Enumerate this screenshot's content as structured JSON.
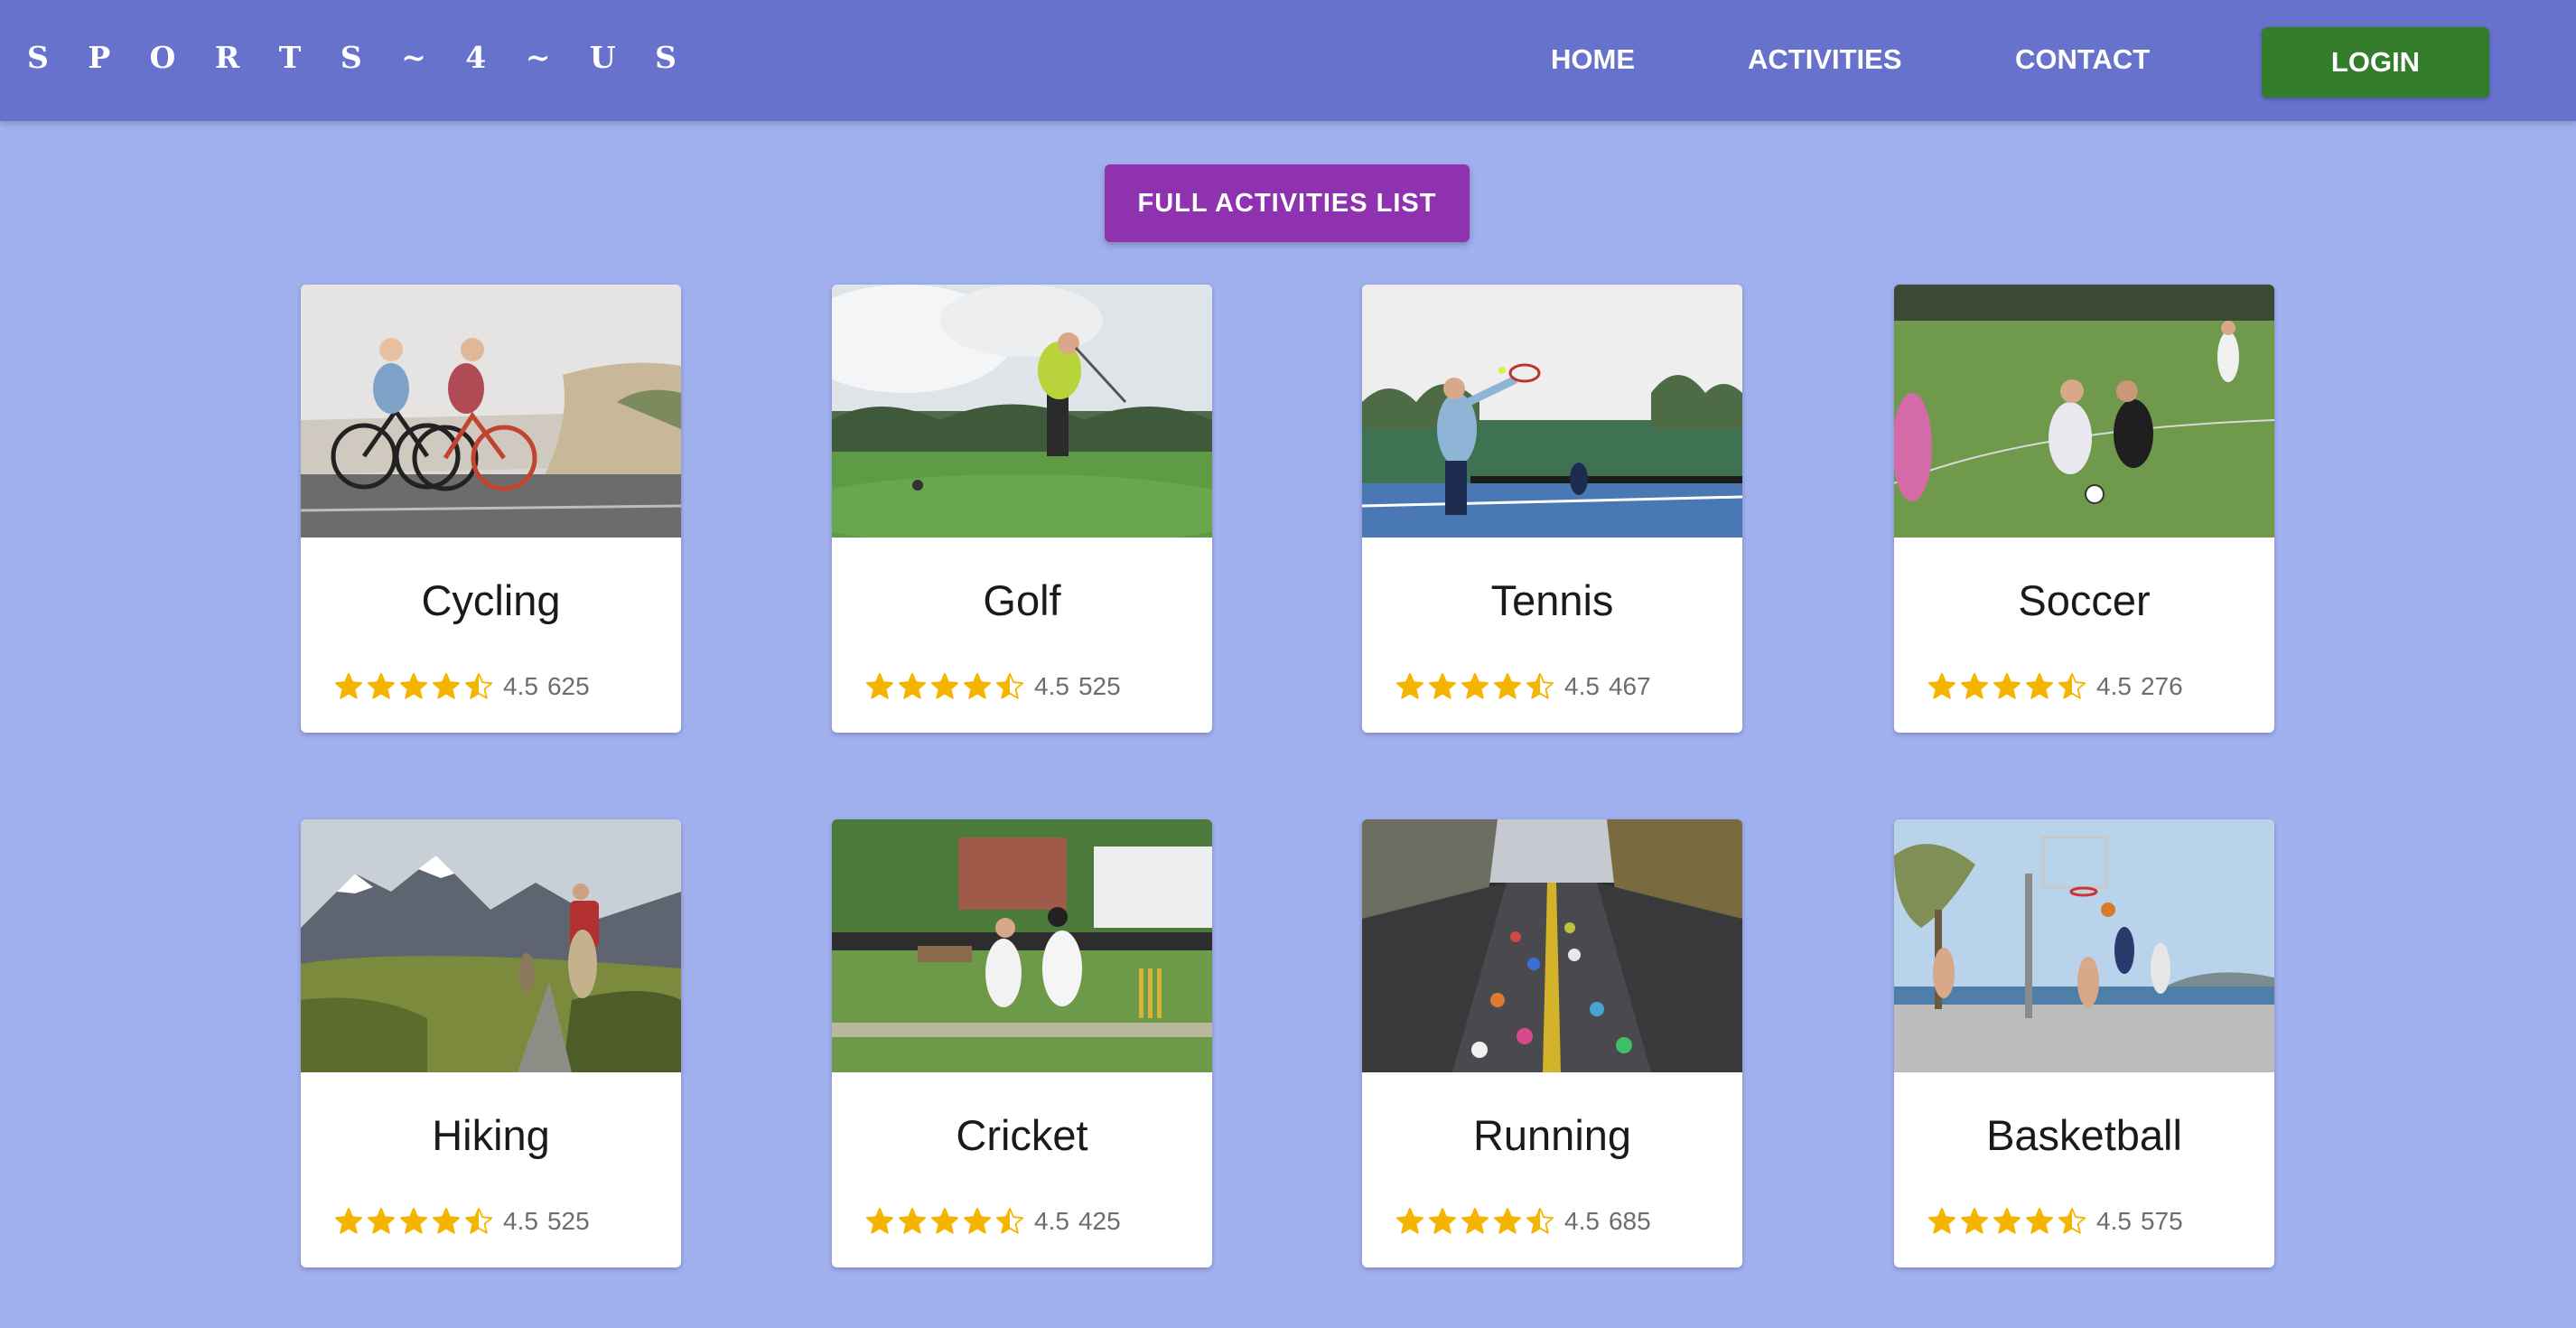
{
  "header": {
    "brand": "S P O R T S ~ 4 ~ U S",
    "nav": [
      "HOME",
      "ACTIVITIES",
      "CONTACT"
    ],
    "login_label": "LOGIN"
  },
  "full_list_label": "FULL ACTIVITIES LIST",
  "colors": {
    "background": "#a1b0ef",
    "navbar": "#6672cc",
    "login_button": "#347d2c",
    "full_list_button": "#8f32af",
    "star": "#f4b400"
  },
  "cards": [
    {
      "title": "Cycling",
      "rating": "4.5",
      "count": "625",
      "stars": 4.5,
      "image": "cyclists-road-photo"
    },
    {
      "title": "Golf",
      "rating": "4.5",
      "count": "525",
      "stars": 4.5,
      "image": "golfer-swing-photo"
    },
    {
      "title": "Tennis",
      "rating": "4.5",
      "count": "467",
      "stars": 4.5,
      "image": "tennis-court-photo"
    },
    {
      "title": "Soccer",
      "rating": "4.5",
      "count": "276",
      "stars": 4.5,
      "image": "soccer-match-photo"
    },
    {
      "title": "Hiking",
      "rating": "4.5",
      "count": "525",
      "stars": 4.5,
      "image": "mountain-hikers-photo"
    },
    {
      "title": "Cricket",
      "rating": "4.5",
      "count": "425",
      "stars": 4.5,
      "image": "cricket-batsman-photo"
    },
    {
      "title": "Running",
      "rating": "4.5",
      "count": "685",
      "stars": 4.5,
      "image": "marathon-runners-photo"
    },
    {
      "title": "Basketball",
      "rating": "4.5",
      "count": "575",
      "stars": 4.5,
      "image": "basketball-court-photo"
    }
  ]
}
